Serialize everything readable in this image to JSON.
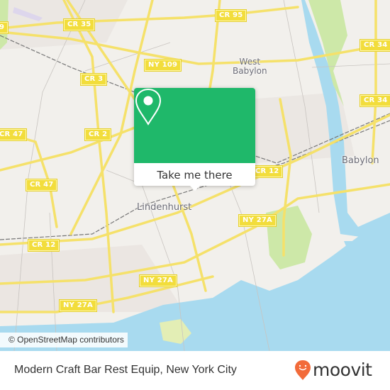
{
  "map": {
    "road_labels": [
      {
        "id": "cr9",
        "text": "9"
      },
      {
        "id": "cr35",
        "text": "CR 35"
      },
      {
        "id": "cr95",
        "text": "CR 95"
      },
      {
        "id": "ny109",
        "text": "NY 109"
      },
      {
        "id": "cr3",
        "text": "CR 3"
      },
      {
        "id": "cr34a",
        "text": "CR 34"
      },
      {
        "id": "cr34b",
        "text": "CR 34"
      },
      {
        "id": "cr47a",
        "text": "CR 47"
      },
      {
        "id": "cr2",
        "text": "CR 2"
      },
      {
        "id": "cr47b",
        "text": "CR 47"
      },
      {
        "id": "cr12a",
        "text": "CR 12"
      },
      {
        "id": "cr12b",
        "text": "CR 12"
      },
      {
        "id": "ny27a1",
        "text": "NY 27A"
      },
      {
        "id": "ny27a2",
        "text": "NY 27A"
      },
      {
        "id": "ny27a3",
        "text": "NY 27A"
      }
    ],
    "place_labels": {
      "west_babylon": "West\nBabylon",
      "babylon": "Babylon",
      "lindenhurst": "Lindenhurst"
    },
    "attribution": "© OpenStreetMap contributors",
    "colors": {
      "land": "#f2f0ec",
      "water": "#a8daef",
      "park": "#cde8a8",
      "road": "#f5e16a",
      "accent": "#1fb86a"
    }
  },
  "popup": {
    "button_label": "Take me there",
    "icon": "map-pin-icon"
  },
  "footer": {
    "title": "Modern Craft Bar Rest Equip, New York City",
    "logo_text": "moovit",
    "logo_color": "#f26b3a"
  }
}
